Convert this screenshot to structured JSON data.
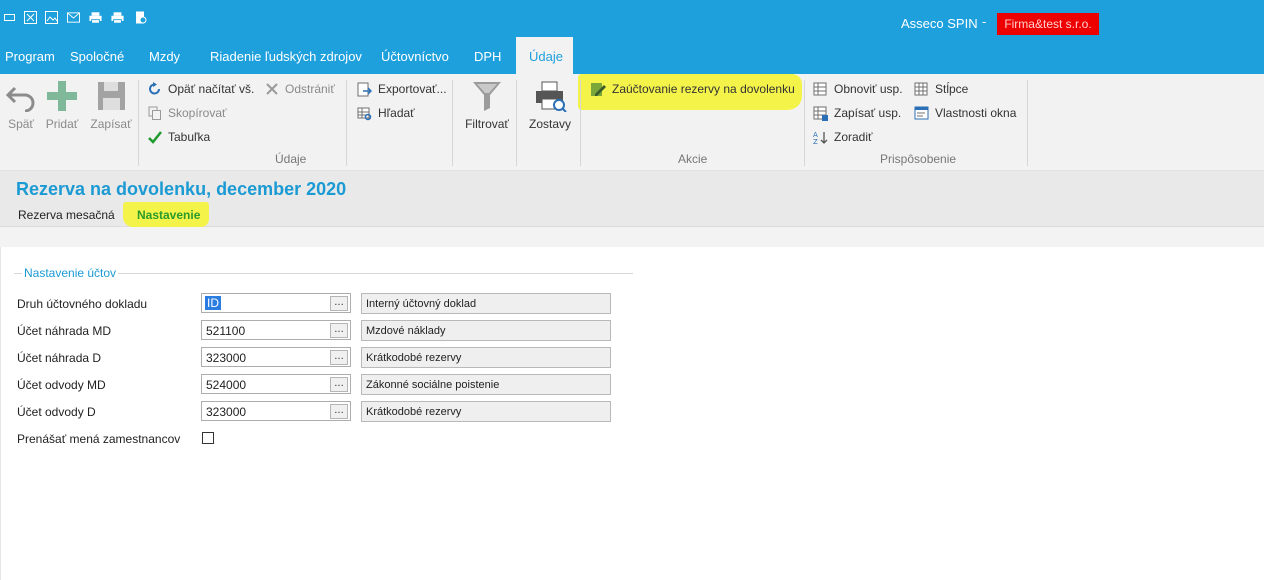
{
  "window": {
    "app_name": "Asseco SPIN",
    "separator": "-",
    "company": "Firma&test s.r.o."
  },
  "quick_access": [
    "window-icon",
    "excel-icon",
    "image-icon",
    "mail-icon",
    "print-icon",
    "print-preview-icon",
    "settings-icon"
  ],
  "menu": {
    "items": [
      "Program",
      "Spoločné",
      "Mzdy",
      "Riadenie ľudských zdrojov",
      "Účtovníctvo",
      "DPH"
    ],
    "active": "Údaje"
  },
  "ribbon": {
    "back": "Späť",
    "add": "Pridať",
    "save": "Zapísať",
    "reload": "Opäť načítať vš.",
    "remove": "Odstrániť",
    "copy": "Skopírovať",
    "table": "Tabuľka",
    "export": "Exportovať...",
    "find": "Hľadať",
    "filter": "Filtrovať",
    "reports": "Zostavy",
    "action": "Zaúčtovanie rezervy na dovolenku",
    "refresh_settings": "Obnoviť usp.",
    "save_settings": "Zapísať usp.",
    "sort": "Zoradiť",
    "columns": "Stĺpce",
    "window_props": "Vlastnosti okna",
    "group_data": "Údaje",
    "group_actions": "Akcie",
    "group_custom": "Prispôsobenie"
  },
  "page": {
    "title": "Rezerva na dovolenku, december 2020",
    "tabs": [
      "Rezerva mesačná",
      "Nastavenie"
    ]
  },
  "form": {
    "section_title": "Nastavenie účtov",
    "rows": [
      {
        "label": "Druh účtovného dokladu",
        "value": "ID",
        "desc": "Interný účtovný doklad"
      },
      {
        "label": "Účet náhrada MD",
        "value": "521100",
        "desc": "Mzdové náklady"
      },
      {
        "label": "Účet náhrada D",
        "value": "323000",
        "desc": "Krátkodobé rezervy"
      },
      {
        "label": "Účet odvody MD",
        "value": "524000",
        "desc": "Zákonné sociálne poistenie"
      },
      {
        "label": "Účet odvody D",
        "value": "323000",
        "desc": "Krátkodobé rezervy"
      }
    ],
    "lookup_button": "...",
    "checkbox_label": "Prenášať mená zamestnancov",
    "checkbox_checked": false
  },
  "colors": {
    "accent": "#1ea0dd",
    "highlight": "#f4f34a",
    "company_bg": "#ee0000",
    "active_tab_text": "#2a9b2a"
  }
}
